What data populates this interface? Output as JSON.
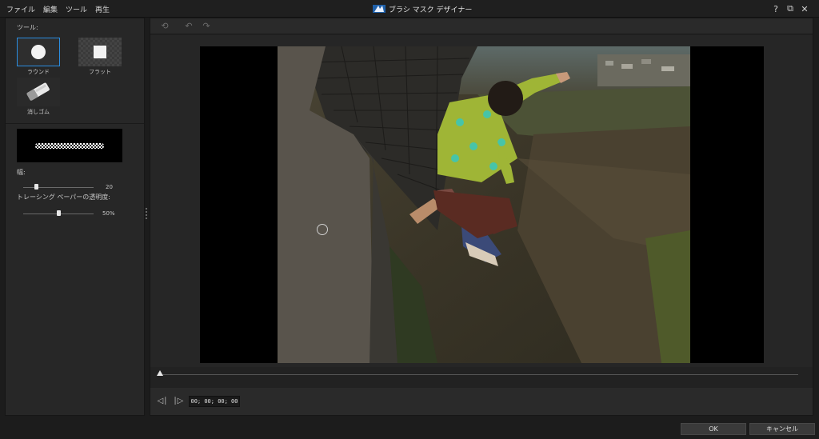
{
  "menu": {
    "file": "ファイル",
    "edit": "編集",
    "tools": "ツール",
    "play": "再生"
  },
  "title": "ブラシ マスク デザイナー",
  "window": {
    "help_icon": "?",
    "restore_icon": "restore-icon",
    "close_icon": "close-icon"
  },
  "tools": {
    "label": "ツール:",
    "round": "ラウンド",
    "flat": "フラット",
    "eraser": "消しゴム"
  },
  "brush": {
    "width_label": "幅:",
    "width_value": "20",
    "width_level": 0.18,
    "opacity_label": "トレーシング ペーパーの透明度:",
    "opacity_value": "50%",
    "opacity_level": 0.5
  },
  "toolbar": {
    "icons": [
      "reset-icon",
      "undo-icon",
      "redo-icon"
    ]
  },
  "playback": {
    "timecode": "00; 00; 00; 00",
    "position": 0
  },
  "footer": {
    "ok": "OK",
    "cancel": "キャンセル"
  },
  "colors": {
    "accent": "#2b8de0",
    "panel": "#272727",
    "background": "#1c1c1c"
  }
}
